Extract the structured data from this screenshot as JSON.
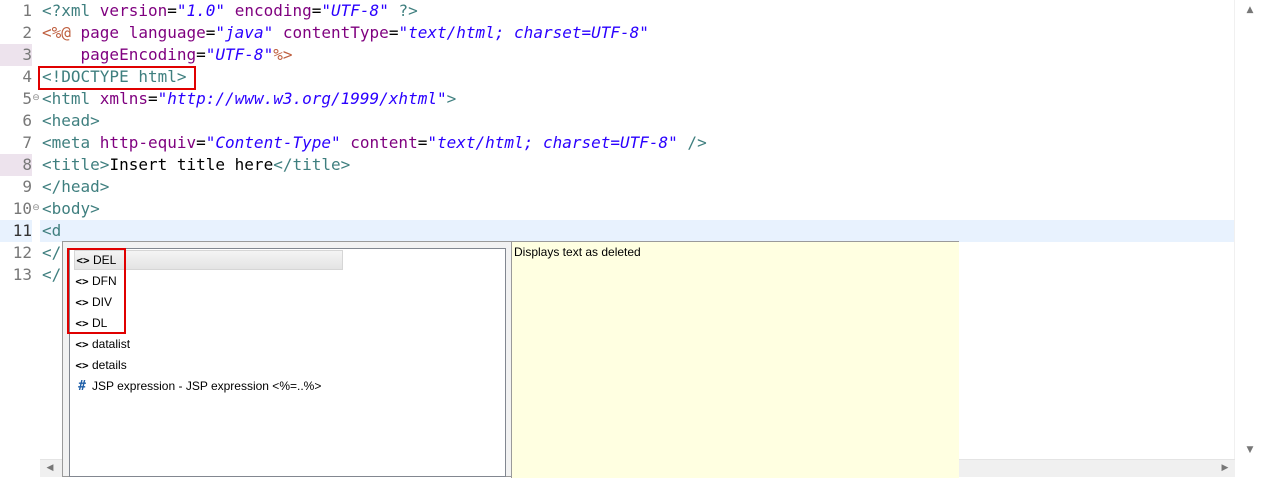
{
  "editor": {
    "line_numbers": [
      "1",
      "2",
      "3",
      "4",
      "5",
      "6",
      "7",
      "8",
      "9",
      "10",
      "11",
      "12",
      "13"
    ],
    "fold_marker": "⊖",
    "lines": [
      [
        {
          "t": "<?xml ",
          "c": "tag"
        },
        {
          "t": "version",
          "c": "attr"
        },
        {
          "t": "=",
          "c": "plain"
        },
        {
          "t": "\"1.0\"",
          "c": "val"
        },
        {
          "t": " ",
          "c": "plain"
        },
        {
          "t": "encoding",
          "c": "attr"
        },
        {
          "t": "=",
          "c": "plain"
        },
        {
          "t": "\"UTF-8\"",
          "c": "val"
        },
        {
          "t": " ?>",
          "c": "tag"
        }
      ],
      [
        {
          "t": "<%@ ",
          "c": "jsp"
        },
        {
          "t": "page ",
          "c": "attr"
        },
        {
          "t": "language",
          "c": "attr"
        },
        {
          "t": "=",
          "c": "plain"
        },
        {
          "t": "\"java\"",
          "c": "val"
        },
        {
          "t": " ",
          "c": "plain"
        },
        {
          "t": "contentType",
          "c": "attr"
        },
        {
          "t": "=",
          "c": "plain"
        },
        {
          "t": "\"text/html; charset=UTF-8\"",
          "c": "val"
        }
      ],
      [
        {
          "t": "    ",
          "c": "plain"
        },
        {
          "t": "pageEncoding",
          "c": "attr"
        },
        {
          "t": "=",
          "c": "plain"
        },
        {
          "t": "\"UTF-8\"",
          "c": "val"
        },
        {
          "t": "%>",
          "c": "jsp"
        }
      ],
      [
        {
          "t": "<!DOCTYPE html>",
          "c": "tag"
        }
      ],
      [
        {
          "t": "<html ",
          "c": "tag"
        },
        {
          "t": "xmlns",
          "c": "attr"
        },
        {
          "t": "=",
          "c": "plain"
        },
        {
          "t": "\"http://www.w3.org/1999/xhtml\"",
          "c": "val"
        },
        {
          "t": ">",
          "c": "tag"
        }
      ],
      [
        {
          "t": "<head>",
          "c": "tag"
        }
      ],
      [
        {
          "t": "<meta ",
          "c": "tag"
        },
        {
          "t": "http-equiv",
          "c": "attr"
        },
        {
          "t": "=",
          "c": "plain"
        },
        {
          "t": "\"Content-Type\"",
          "c": "val"
        },
        {
          "t": " ",
          "c": "plain"
        },
        {
          "t": "content",
          "c": "attr"
        },
        {
          "t": "=",
          "c": "plain"
        },
        {
          "t": "\"text/html; charset=UTF-8\"",
          "c": "val"
        },
        {
          "t": " />",
          "c": "tag"
        }
      ],
      [
        {
          "t": "<title>",
          "c": "tag"
        },
        {
          "t": "Insert title here",
          "c": "plain"
        },
        {
          "t": "</title>",
          "c": "tag"
        }
      ],
      [
        {
          "t": "</head>",
          "c": "tag"
        }
      ],
      [
        {
          "t": "<body>",
          "c": "tag"
        }
      ],
      [
        {
          "t": "<d",
          "c": "tag"
        }
      ],
      [
        {
          "t": "</",
          "c": "tag"
        }
      ],
      [
        {
          "t": "</",
          "c": "tag"
        }
      ]
    ]
  },
  "autocomplete": {
    "items": [
      {
        "icon": "<>",
        "label": "DEL"
      },
      {
        "icon": "<>",
        "label": "DFN"
      },
      {
        "icon": "<>",
        "label": "DIV"
      },
      {
        "icon": "<>",
        "label": "DL"
      },
      {
        "icon": "<>",
        "label": "datalist"
      },
      {
        "icon": "<>",
        "label": "details"
      },
      {
        "icon": "#",
        "label": "JSP expression - JSP expression <%=..%>"
      }
    ],
    "description": "Displays text as deleted"
  },
  "colors": {
    "tag": "#3f7f7f",
    "attribute": "#7f007f",
    "value": "#2a00ff",
    "jsp_delimiter": "#bf5f3f",
    "current_line": "#e8f2fe",
    "annotation_box": "#e00000",
    "doc_background": "#ffffe1"
  }
}
